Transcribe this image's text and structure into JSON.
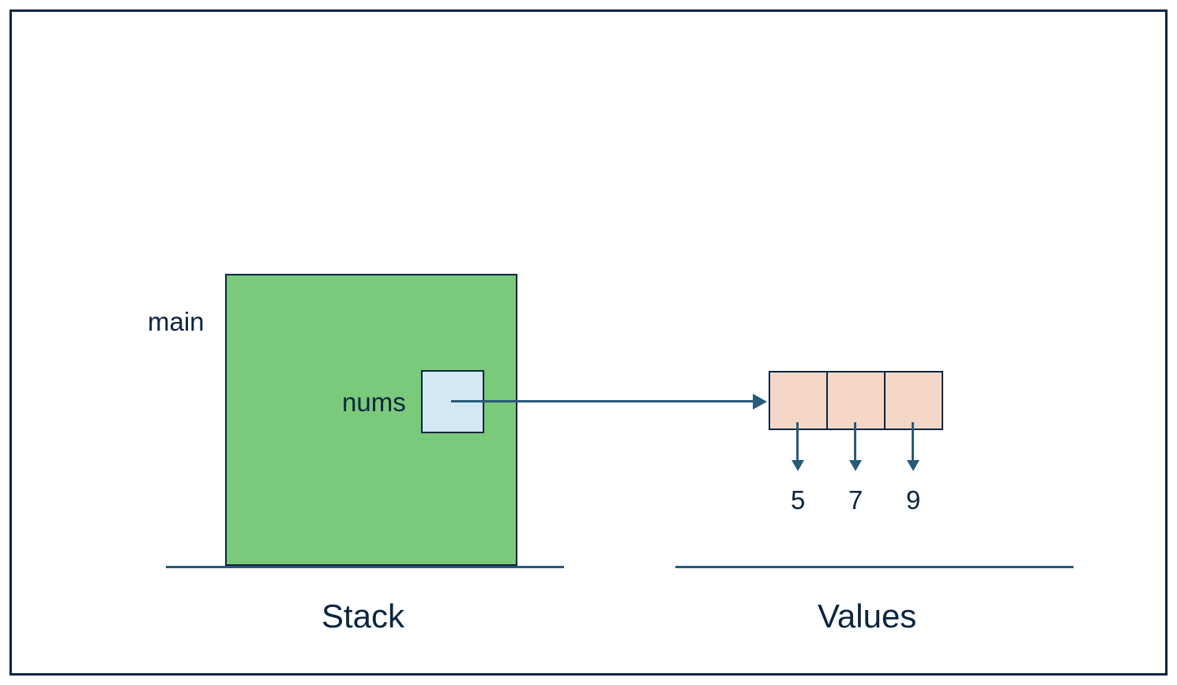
{
  "colors": {
    "frame_border": "#0a2540",
    "stack_fill": "#7bc97b",
    "var_fill": "#d4e8f3",
    "array_fill": "#f5d7c8",
    "arrow": "#285a7a"
  },
  "stack": {
    "frame_label": "main",
    "variable_label": "nums",
    "region_label": "Stack"
  },
  "values": {
    "region_label": "Values",
    "array": [
      "5",
      "7",
      "9"
    ]
  }
}
